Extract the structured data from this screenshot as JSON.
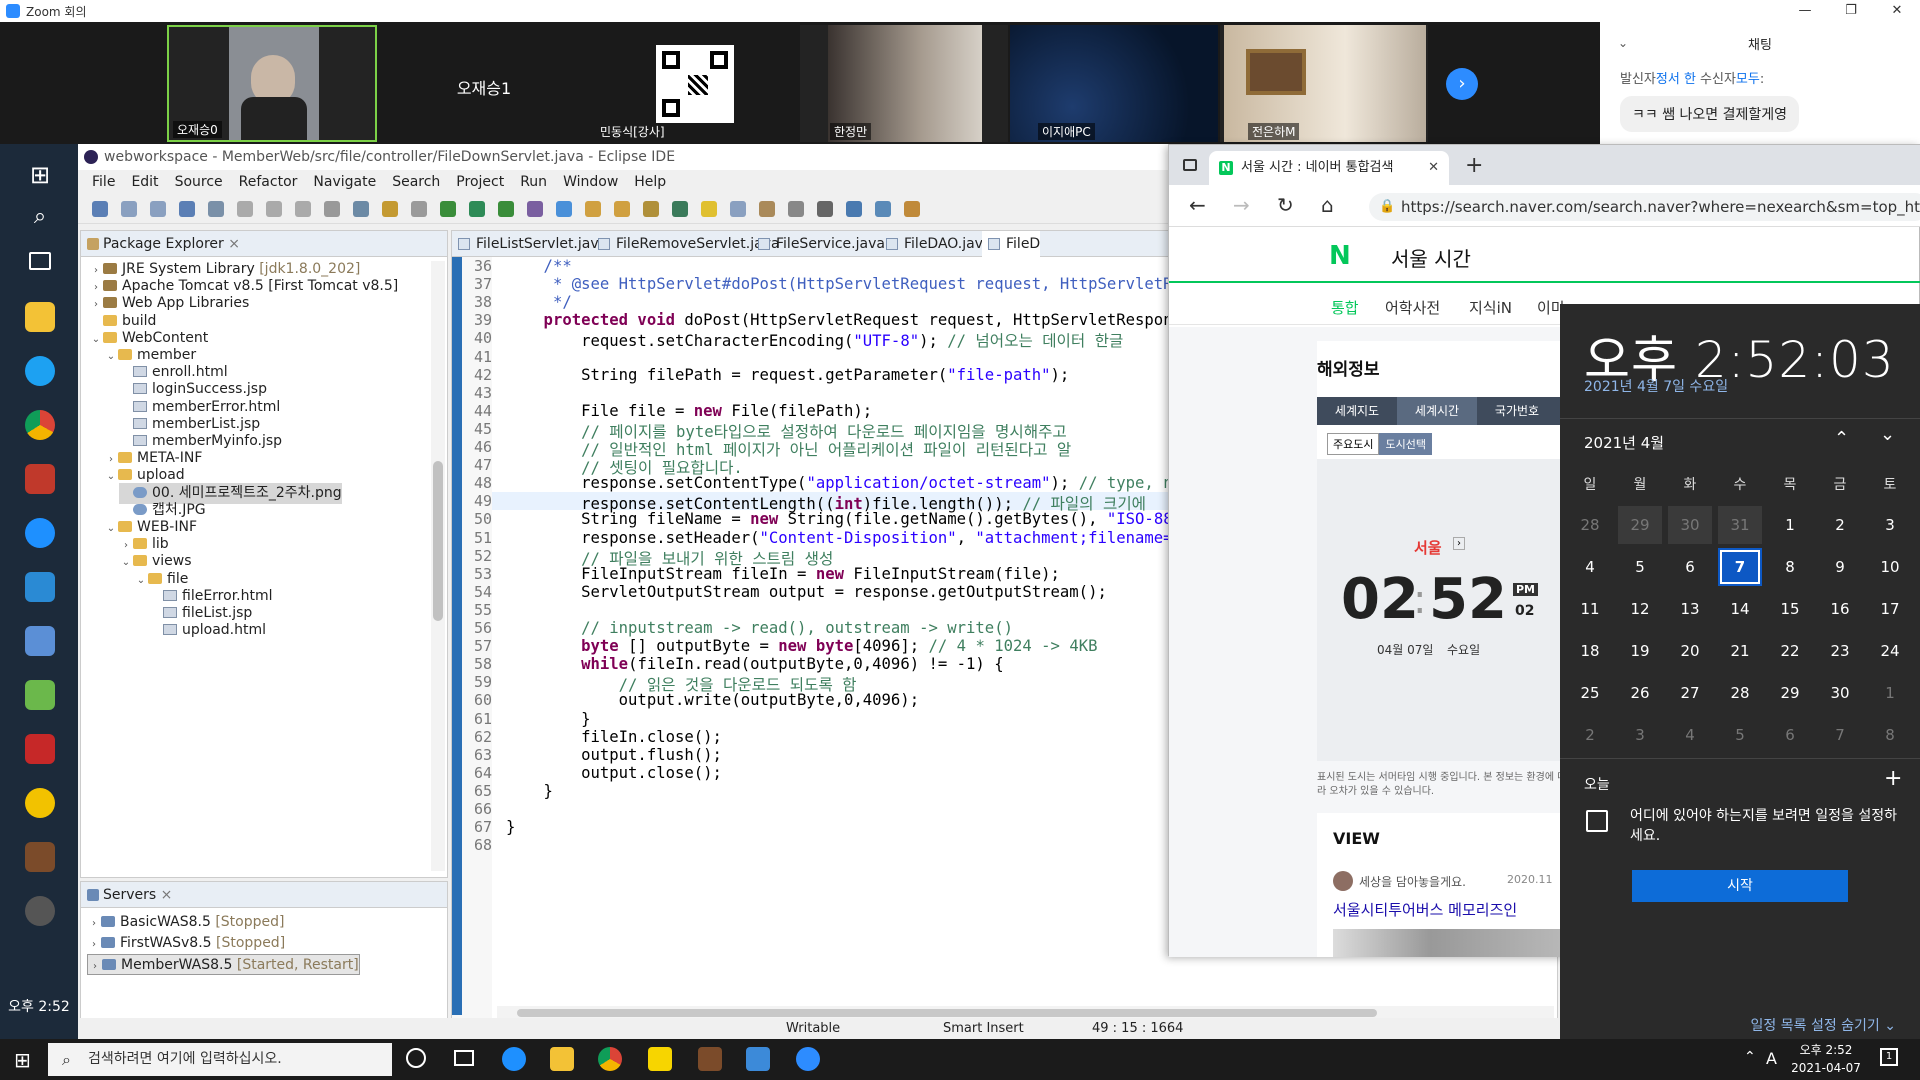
{
  "zoom": {
    "window_title": "Zoom 회의",
    "participants": [
      {
        "name": "오재승0"
      },
      {
        "name": "오재승1"
      },
      {
        "name": "민동식[강사]"
      },
      {
        "name": "한정만"
      },
      {
        "name": "이지애PC"
      },
      {
        "name": "전은하M"
      }
    ],
    "chat": {
      "title": "채팅",
      "meta_prefix": "발신자",
      "meta_sender": "정서 한",
      "meta_mid": " 수신자",
      "meta_recipient": "모두",
      "meta_suffix": ":",
      "message": "ㅋㅋ 쌤 나오면 결제할게영"
    }
  },
  "eclipse": {
    "title": "webworkspace - MemberWeb/src/file/controller/FileDownServlet.java - Eclipse IDE",
    "menu": [
      "File",
      "Edit",
      "Source",
      "Refactor",
      "Navigate",
      "Search",
      "Project",
      "Run",
      "Window",
      "Help"
    ],
    "package_explorer_title": "Package Explorer",
    "tree": [
      {
        "text": "JRE System Library",
        "extra": " [jdk1.8.0_202]",
        "indent": 1,
        "tw": "›",
        "icon": "lib"
      },
      {
        "text": "Apache Tomcat v8.5 [First Tomcat v8.5]",
        "extra": "",
        "indent": 1,
        "tw": "›",
        "icon": "lib"
      },
      {
        "text": "Web App Libraries",
        "extra": "",
        "indent": 1,
        "tw": "›",
        "icon": "lib"
      },
      {
        "text": "build",
        "extra": "",
        "indent": 1,
        "tw": "",
        "icon": "folder"
      },
      {
        "text": "WebContent",
        "extra": "",
        "indent": 1,
        "tw": "⌄",
        "icon": "folder"
      },
      {
        "text": "member",
        "extra": "",
        "indent": 2,
        "tw": "⌄",
        "icon": "folder"
      },
      {
        "text": "enroll.html",
        "extra": "",
        "indent": 3,
        "tw": "",
        "icon": "file"
      },
      {
        "text": "loginSuccess.jsp",
        "extra": "",
        "indent": 3,
        "tw": "",
        "icon": "file"
      },
      {
        "text": "memberError.html",
        "extra": "",
        "indent": 3,
        "tw": "",
        "icon": "file"
      },
      {
        "text": "memberList.jsp",
        "extra": "",
        "indent": 3,
        "tw": "",
        "icon": "file"
      },
      {
        "text": "memberMyinfo.jsp",
        "extra": "",
        "indent": 3,
        "tw": "",
        "icon": "file"
      },
      {
        "text": "META-INF",
        "extra": "",
        "indent": 2,
        "tw": "›",
        "icon": "folder"
      },
      {
        "text": "upload",
        "extra": "",
        "indent": 2,
        "tw": "⌄",
        "icon": "folder"
      },
      {
        "text": "00. 세미프로젝트조_2주차.png",
        "extra": "",
        "indent": 3,
        "tw": "",
        "icon": "img"
      },
      {
        "text": "캡처.JPG",
        "extra": "",
        "indent": 3,
        "tw": "",
        "icon": "img"
      },
      {
        "text": "WEB-INF",
        "extra": "",
        "indent": 2,
        "tw": "⌄",
        "icon": "folder"
      },
      {
        "text": "lib",
        "extra": "",
        "indent": 3,
        "tw": "›",
        "icon": "folder"
      },
      {
        "text": "views",
        "extra": "",
        "indent": 3,
        "tw": "⌄",
        "icon": "folder"
      },
      {
        "text": "file",
        "extra": "",
        "indent": 4,
        "tw": "⌄",
        "icon": "folder"
      },
      {
        "text": "fileError.html",
        "extra": "",
        "indent": 5,
        "tw": "",
        "icon": "file"
      },
      {
        "text": "fileList.jsp",
        "extra": "",
        "indent": 5,
        "tw": "",
        "icon": "file"
      },
      {
        "text": "upload.html",
        "extra": "",
        "indent": 5,
        "tw": "",
        "icon": "file"
      }
    ],
    "servers_title": "Servers",
    "servers": [
      {
        "name": "BasicWAS8.5",
        "state": "[Stopped]"
      },
      {
        "name": "FirstWASv8.5",
        "state": "[Stopped]"
      },
      {
        "name": "MemberWAS8.5",
        "state": "[Started, Restart]"
      }
    ],
    "editor_tabs": [
      "FileListServlet.java",
      "FileRemoveServlet.java",
      "FileService.java",
      "FileDAO.java",
      "FileD"
    ],
    "lines": [
      {
        "n": "36",
        "parts": [
          {
            "c": "jd",
            "t": "    /**"
          }
        ]
      },
      {
        "n": "37",
        "parts": [
          {
            "c": "jd",
            "t": "     * @see HttpServlet#doPost(HttpServletRequest request, HttpServletR"
          }
        ]
      },
      {
        "n": "38",
        "parts": [
          {
            "c": "jd",
            "t": "     */"
          }
        ]
      },
      {
        "n": "39",
        "parts": [
          {
            "c": "kw",
            "t": "    protected void "
          },
          {
            "c": "",
            "t": "doPost(HttpServletRequest request, HttpServletRespon"
          }
        ]
      },
      {
        "n": "40",
        "parts": [
          {
            "c": "",
            "t": "        request.setCharacterEncoding("
          },
          {
            "c": "st",
            "t": "\"UTF-8\""
          },
          {
            "c": "",
            "t": "); "
          },
          {
            "c": "cm",
            "t": "// 넘어오는 데이터 한글"
          }
        ]
      },
      {
        "n": "41",
        "parts": [
          {
            "c": "",
            "t": ""
          }
        ]
      },
      {
        "n": "42",
        "parts": [
          {
            "c": "",
            "t": "        String filePath = request.getParameter("
          },
          {
            "c": "st",
            "t": "\"file-path\""
          },
          {
            "c": "",
            "t": ");"
          }
        ]
      },
      {
        "n": "43",
        "parts": [
          {
            "c": "",
            "t": ""
          }
        ]
      },
      {
        "n": "44",
        "parts": [
          {
            "c": "",
            "t": "        File file = "
          },
          {
            "c": "kw",
            "t": "new "
          },
          {
            "c": "",
            "t": "File(filePath);"
          }
        ]
      },
      {
        "n": "45",
        "parts": [
          {
            "c": "cm",
            "t": "        // 페이지를 byte타입으로 설정하여 다운로드 페이지임을 명시해주고"
          }
        ]
      },
      {
        "n": "46",
        "parts": [
          {
            "c": "cm",
            "t": "        // 일반적인 html 페이지가 아닌 어플리케이션 파일이 리턴된다고 알"
          }
        ]
      },
      {
        "n": "47",
        "parts": [
          {
            "c": "cm",
            "t": "        // 셋팅이 필요합니다."
          }
        ]
      },
      {
        "n": "48",
        "parts": [
          {
            "c": "",
            "t": "        response.setContentType("
          },
          {
            "c": "st",
            "t": "\"application/octet-stream\""
          },
          {
            "c": "",
            "t": "); "
          },
          {
            "c": "cm",
            "t": "// type, n"
          }
        ]
      },
      {
        "n": "49",
        "parts": [
          {
            "c": "",
            "t": "        response.setContentLength(("
          },
          {
            "c": "kw",
            "t": "int"
          },
          {
            "c": "",
            "t": ")file.length()); "
          },
          {
            "c": "cm",
            "t": "// 파일의 크기에"
          }
        ]
      },
      {
        "n": "50",
        "parts": [
          {
            "c": "",
            "t": "        String fileName = "
          },
          {
            "c": "kw",
            "t": "new "
          },
          {
            "c": "",
            "t": "String(file.getName().getBytes(), "
          },
          {
            "c": "st",
            "t": "\"ISO-88"
          }
        ]
      },
      {
        "n": "51",
        "parts": [
          {
            "c": "",
            "t": "        response.setHeader("
          },
          {
            "c": "st",
            "t": "\"Content-Disposition\""
          },
          {
            "c": "",
            "t": ", "
          },
          {
            "c": "st",
            "t": "\"attachment;filename="
          }
        ]
      },
      {
        "n": "52",
        "parts": [
          {
            "c": "cm",
            "t": "        // 파일을 보내기 위한 스트림 생성"
          }
        ]
      },
      {
        "n": "53",
        "parts": [
          {
            "c": "",
            "t": "        FileInputStream fileIn = "
          },
          {
            "c": "kw",
            "t": "new "
          },
          {
            "c": "",
            "t": "FileInputStream(file);"
          }
        ]
      },
      {
        "n": "54",
        "parts": [
          {
            "c": "",
            "t": "        ServletOutputStream output = response.getOutputStream();"
          }
        ]
      },
      {
        "n": "55",
        "parts": [
          {
            "c": "",
            "t": ""
          }
        ]
      },
      {
        "n": "56",
        "parts": [
          {
            "c": "cm",
            "t": "        // inputstream -> read(), outstream -> write()"
          }
        ]
      },
      {
        "n": "57",
        "parts": [
          {
            "c": "kw",
            "t": "        byte "
          },
          {
            "c": "",
            "t": "[] outputByte = "
          },
          {
            "c": "kw",
            "t": "new byte"
          },
          {
            "c": "",
            "t": "[4096]; "
          },
          {
            "c": "cm",
            "t": "// 4 * 1024 -> 4KB"
          }
        ]
      },
      {
        "n": "58",
        "parts": [
          {
            "c": "kw",
            "t": "        while"
          },
          {
            "c": "",
            "t": "(fileIn.read(outputByte,0,4096) != -1) {"
          }
        ]
      },
      {
        "n": "59",
        "parts": [
          {
            "c": "cm",
            "t": "            // 읽은 것을 다운로드 되도록 함"
          }
        ]
      },
      {
        "n": "60",
        "parts": [
          {
            "c": "",
            "t": "            output.write(outputByte,0,4096);"
          }
        ]
      },
      {
        "n": "61",
        "parts": [
          {
            "c": "",
            "t": "        }"
          }
        ]
      },
      {
        "n": "62",
        "parts": [
          {
            "c": "",
            "t": "        fileIn.close();"
          }
        ]
      },
      {
        "n": "63",
        "parts": [
          {
            "c": "",
            "t": "        output.flush();"
          }
        ]
      },
      {
        "n": "64",
        "parts": [
          {
            "c": "",
            "t": "        output.close();"
          }
        ]
      },
      {
        "n": "65",
        "parts": [
          {
            "c": "",
            "t": "    }"
          }
        ]
      },
      {
        "n": "66",
        "parts": [
          {
            "c": "",
            "t": ""
          }
        ]
      },
      {
        "n": "67",
        "parts": [
          {
            "c": "",
            "t": "}"
          }
        ]
      },
      {
        "n": "68",
        "parts": [
          {
            "c": "",
            "t": ""
          }
        ]
      }
    ],
    "status": {
      "writable": "Writable",
      "insert": "Smart Insert",
      "position": "49 : 15 : 1664"
    }
  },
  "browser": {
    "tab_title": "서울 시간 : 네이버 통합검색",
    "url": "https://search.naver.com/search.naver?where=nexearch&sm=top_hty&fbm",
    "logo": "N",
    "query": "서울 시간",
    "nav": [
      "통합",
      "어학사전",
      "지식iN",
      "이미"
    ],
    "section_title": "해외정보",
    "info_tabs": [
      "세계지도",
      "세계시간",
      "국가번호"
    ],
    "sub_tabs": [
      "주요도시",
      "도시선택"
    ],
    "city": "서울",
    "clock_hh": "02",
    "clock_mm": "52",
    "clock_ampm": "PM",
    "clock_ss": "02",
    "clock_date": "04월 07일",
    "clock_weekday": "수요일",
    "notice": "표시된 도시는 서머타임 시행 중입니다. 본 정보는 환경에 따라 오차가 있을 수 있습니다.",
    "view_title": "VIEW",
    "view_author": "세상을 담아놓을게요.",
    "view_date": "2020.11",
    "view_link": "서울시티투어버스 메모리즈인"
  },
  "calendar": {
    "time": "오후 2:52:03",
    "date": "2021년 4월 7일 수요일",
    "month": "2021년 4월",
    "weekdays": [
      "일",
      "월",
      "화",
      "수",
      "목",
      "금",
      "토"
    ],
    "days": [
      "28",
      "29",
      "30",
      "31",
      "1",
      "2",
      "3",
      "4",
      "5",
      "6",
      "7",
      "8",
      "9",
      "10",
      "11",
      "12",
      "13",
      "14",
      "15",
      "16",
      "17",
      "18",
      "19",
      "20",
      "21",
      "22",
      "23",
      "24",
      "25",
      "26",
      "27",
      "28",
      "29",
      "30",
      "1",
      "2",
      "3",
      "4",
      "5",
      "6",
      "7",
      "8"
    ],
    "today_label": "오늘",
    "event_text": "어디에 있어야 하는지를 보려면 일정을 설정하세요.",
    "start_label": "시작",
    "hide_label": "일정 목록 설정 숨기기"
  },
  "taskbar": {
    "search_placeholder": "검색하려면 여기에 입력하십시오.",
    "left_clock": "오후 2:52",
    "clock_time": "오후 2:52",
    "clock_date": "2021-04-07",
    "ime": "A",
    "notification_count": "1"
  }
}
